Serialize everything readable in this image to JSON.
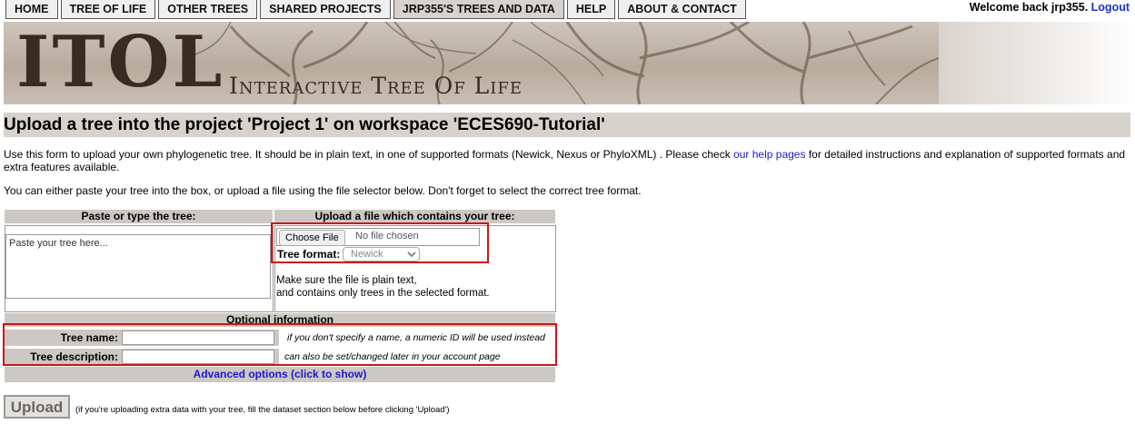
{
  "nav": {
    "tabs": [
      "HOME",
      "TREE OF LIFE",
      "OTHER TREES",
      "SHARED PROJECTS",
      "JRP355'S TREES AND DATA",
      "HELP",
      "ABOUT & CONTACT"
    ],
    "welcome": "Welcome back jrp355.",
    "logout": "Logout"
  },
  "banner": {
    "logo": "ITOL",
    "tagline": "Interactive Tree Of Life"
  },
  "page": {
    "title": "Upload a tree into the project 'Project 1' on workspace 'ECES690-Tutorial'",
    "intro_before": "Use this form to upload your own phylogenetic tree. It should be in plain text, in one of supported formats (Newick, Nexus or PhyloXML) . Please check ",
    "intro_link": "our help pages",
    "intro_after": " for detailed instructions and explanation of supported formats and extra features available.",
    "intro2": "You can either paste your tree into the box, or upload a file using the file selector below. Don't forget to select the correct tree format."
  },
  "form": {
    "paste_header": "Paste or type the tree:",
    "paste_placeholder": "Paste your tree here...",
    "upload_header": "Upload a file which contains your tree:",
    "choose_file": "Choose File",
    "no_file": "No file chosen",
    "format_label": "Tree format:",
    "format_value": "Newick",
    "format_note_1": "Make sure the file is plain text,",
    "format_note_2": "and contains only trees in the selected format.",
    "optional_header": "Optional information",
    "name_label": "Tree name:",
    "name_hint": "if you don't specify a name, a numeric ID will be used instead",
    "desc_label": "Tree description:",
    "desc_hint": "can also be set/changed later in your account page",
    "advanced": "Advanced options (click to show)",
    "upload_button": "Upload",
    "upload_note": "(if you're uploading extra data with your tree, fill the dataset section below before clicking 'Upload')"
  },
  "colors": {
    "highlight": "#d01515",
    "link": "#1a1acc",
    "header_bg": "#cdc8c3"
  }
}
